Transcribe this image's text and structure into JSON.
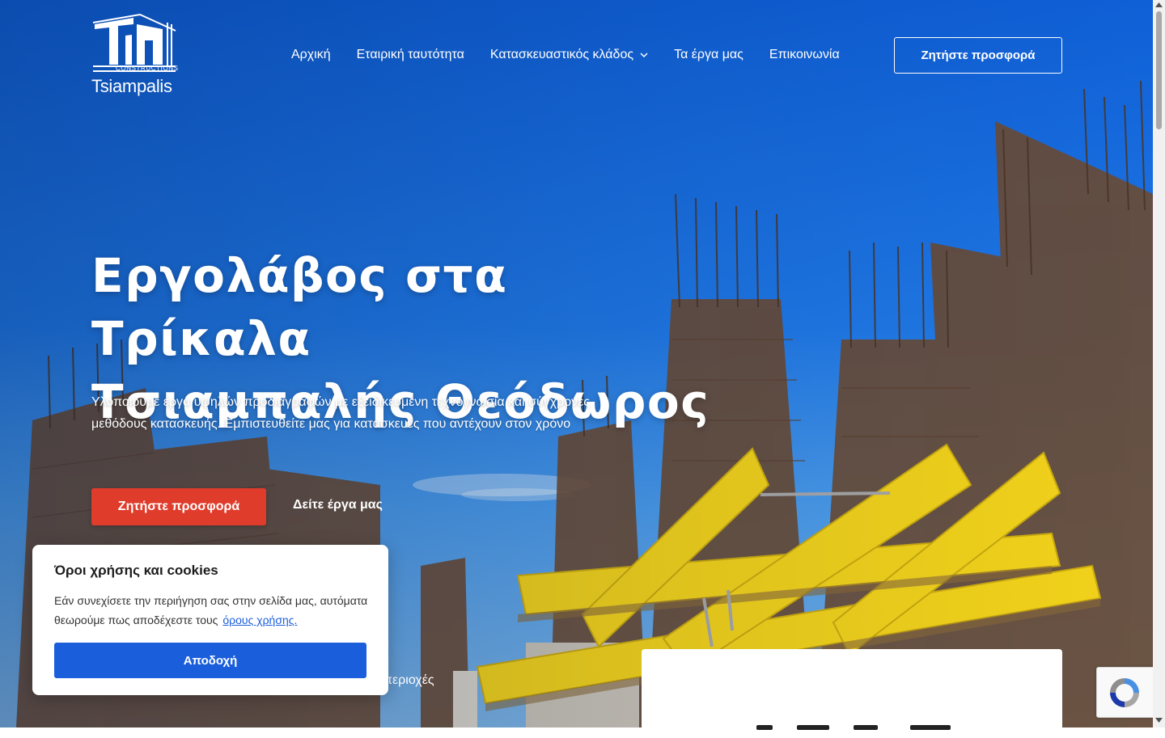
{
  "brand": {
    "logo_word": "Tsiampalis",
    "logo_sub": "CONSTRUCTIONS"
  },
  "nav": {
    "items": [
      {
        "label": "Αρχική"
      },
      {
        "label": "Εταιρική ταυτότητα"
      },
      {
        "label": "Κατασκευαστικός κλάδος",
        "has_dropdown": true
      },
      {
        "label": "Τα έργα μας"
      },
      {
        "label": "Επικοινωνία"
      }
    ],
    "cta_label": "Ζητήστε προσφορά"
  },
  "hero": {
    "title_line1": "Εργολάβος στα Τρίκαλα",
    "title_line2": "Τσιαμπαλής Θεόδωρος",
    "lead": "Υλοποιούμε έργα υψηλών προδιαγραφών με εξειδικευμένη τεχνογνωσία και σύγχρονες μεθόδους κατασκευής. Εμπιστευθείτε μας για κατασκευές που αντέχουν στον χρόνο",
    "primary_button": "Ζητήστε προσφορά",
    "secondary_link": "Δείτε έργα μας",
    "partial_text": "περιοχές"
  },
  "cookie": {
    "title": "Όροι χρήσης και cookies",
    "body": "Εάν συνεχίσετε την περιήγηση σας στην σελίδα μας, αυτόματα θεωρούμε πως αποδέχεστε τους",
    "link": "όρους χρήσης.",
    "accept": "Αποδοχή"
  },
  "colors": {
    "accent_red": "#e03c2b",
    "cookie_blue": "#1a5edc",
    "sky": "#1f78e6"
  }
}
